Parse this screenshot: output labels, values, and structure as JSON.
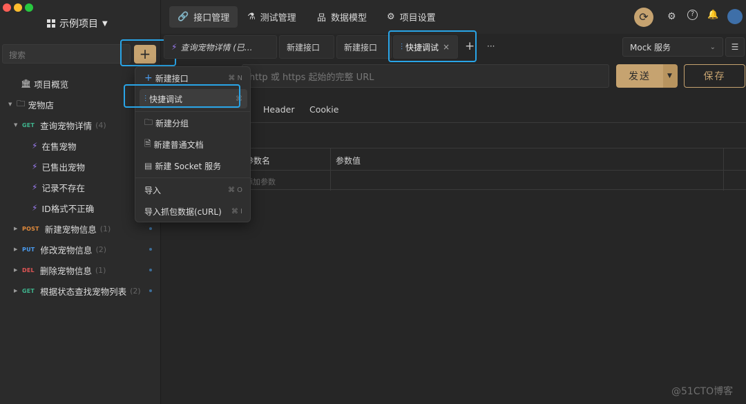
{
  "app": {
    "project_name": "示例项目"
  },
  "colors": {
    "accent": "#c6a370",
    "highlight": "#29a5e8",
    "get": "#3fb58e",
    "post": "#e08a3c",
    "put": "#4a9cf0",
    "delete": "#e05555"
  },
  "sidebar": {
    "search_placeholder": "搜索",
    "add_button": "+",
    "overview": "项目概览",
    "folder": "宠物店",
    "items": [
      {
        "method": "GET",
        "name": "查询宠物详情",
        "count": "(4)"
      },
      {
        "name": "在售宠物"
      },
      {
        "name": "已售出宠物"
      },
      {
        "name": "记录不存在"
      },
      {
        "name": "ID格式不正确"
      },
      {
        "method": "POST",
        "name": "新建宠物信息",
        "count": "(1)"
      },
      {
        "method": "PUT",
        "name": "修改宠物信息",
        "count": "(2)"
      },
      {
        "method": "DEL",
        "name": "删除宠物信息",
        "count": "(1)"
      },
      {
        "method": "GET",
        "name": "根据状态查找宠物列表",
        "count": "(2)"
      }
    ]
  },
  "topnav": {
    "tabs": [
      "接口管理",
      "测试管理",
      "数据模型",
      "项目设置"
    ]
  },
  "request_tabs": {
    "items": [
      "查询宠物详情 (已...",
      "新建接口",
      "新建接口",
      "快捷调试"
    ],
    "close": "×",
    "add": "+",
    "more": "···"
  },
  "environment": {
    "selected": "Mock 服务"
  },
  "url_bar": {
    "placeholder": "http 或 https 起始的完整 URL"
  },
  "buttons": {
    "send": "发送",
    "save": "保存"
  },
  "param_tabs": [
    "Header",
    "Cookie"
  ],
  "params_table": {
    "col1": "参数名",
    "col2": "参数值",
    "placeholder": "添加参数"
  },
  "dropdown": {
    "items": [
      {
        "label": "新建接口",
        "shortcut": "⌘ N"
      },
      {
        "label": "快捷调试",
        "shortcut": "⌘"
      },
      {
        "label": "新建分组",
        "shortcut": ""
      },
      {
        "label": "新建普通文档",
        "shortcut": ""
      },
      {
        "label": "新建 Socket 服务",
        "shortcut": ""
      },
      {
        "label": "导入",
        "shortcut": "⌘ O"
      },
      {
        "label": "导入抓包数据(cURL)",
        "shortcut": "⌘ I"
      }
    ]
  },
  "watermark": "@51CTO博客"
}
